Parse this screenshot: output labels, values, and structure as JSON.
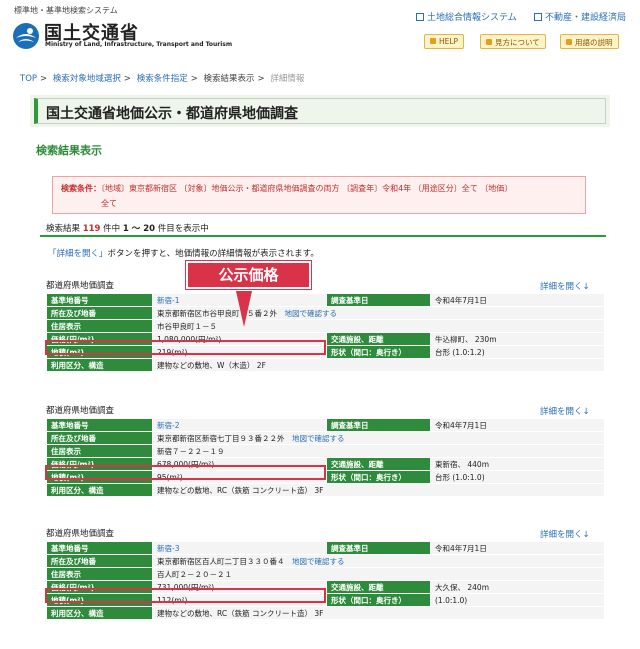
{
  "header": {
    "system_title": "標準地・基準地検索システム",
    "ministry_name": "国土交通省",
    "ministry_en": "Ministry of Land, Infrastructure, Transport and Tourism",
    "links": [
      "土地総合情報システム",
      "不動産・建設経済局"
    ],
    "buttons": [
      "HELP",
      "見方について",
      "用語の説明"
    ]
  },
  "breadcrumb": {
    "items": [
      "TOP",
      "検索対象地域選択",
      "検索条件指定",
      "検索結果表示"
    ],
    "current": "詳細情報"
  },
  "page_title": "国土交通省地価公示・都道府県地価調査",
  "section_title": "検索結果表示",
  "conditions": {
    "label": "検索条件：",
    "line1": "〔地域〕東京都新宿区 〔対象〕地価公示・都道府県地価調査の両方 〔調査年〕令和4年 〔用途区分〕全て 〔地価〕",
    "line2": "全て"
  },
  "result_count": {
    "prefix": "検索結果",
    "total": "119",
    "mid": "件中",
    "range": "1 ～ 20",
    "suffix": "件目を表示中"
  },
  "hint": {
    "link": "「詳細を開く」",
    "text": "ボタンを押すと、地価情報の詳細情報が表示されます。"
  },
  "callout": "公示価格",
  "labels": {
    "std_no": "基準地番号",
    "survey_date": "調査基準日",
    "address": "所在及び地番",
    "residence": "住居表示",
    "price": "価格(円/m²)",
    "transport": "交通施設、距離",
    "area": "地積(m²)",
    "shape": "形状（間口：奥行き）",
    "use": "利用区分、構造",
    "map_link": "地図で確認する",
    "open_detail": "詳細を開く↓"
  },
  "records": [
    {
      "category": "都道府県地価調査",
      "std_no": "新宿-1",
      "survey_date": "令和4年7月1日",
      "address": "東京都新宿区市谷甲良町２５番２外",
      "residence": "市谷甲良町１－５",
      "price": "1,080,000(円/m²)",
      "transport": "牛込柳町、 230m",
      "area": "219(m²)",
      "shape": "台形 (1.0:1.2)",
      "use": "建物などの敷地、W（木造） 2F"
    },
    {
      "category": "都道府県地価調査",
      "std_no": "新宿-2",
      "survey_date": "令和4年7月1日",
      "address": "東京都新宿区新宿七丁目９３番２２外",
      "residence": "新宿７－２２－１９",
      "price": "678,000(円/m²)",
      "transport": "東新宿、 440m",
      "area": "95(m²)",
      "shape": "台形 (1.0:1.0)",
      "use": "建物などの敷地、RC（鉄筋 コンクリート造） 3F"
    },
    {
      "category": "都道府県地価調査",
      "std_no": "新宿-3",
      "survey_date": "令和4年7月1日",
      "address": "東京都新宿区百人町二丁目３３０番４",
      "residence": "百人町２－２０－２１",
      "price": "731,000(円/m²)",
      "transport": "大久保、 240m",
      "area": "112(m²)",
      "shape": "(1.0:1.0)",
      "use": "建物などの敷地、RC（鉄筋 コンクリート造） 3F"
    }
  ]
}
